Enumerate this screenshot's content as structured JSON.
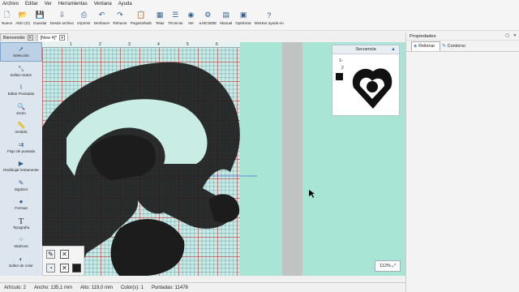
{
  "menu": [
    "Archivo",
    "Editar",
    "Ver",
    "Herramientas",
    "Ventana",
    "Ayuda"
  ],
  "toolbar": [
    {
      "label": "Nuevo",
      "icon": "new-file-icon"
    },
    {
      "label": "Abrir (O)",
      "icon": "open-folder-icon"
    },
    {
      "label": "Guardar",
      "icon": "save-icon"
    },
    {
      "label": "Desde archivo",
      "icon": "import-file-icon"
    },
    {
      "label": "Imprimir",
      "icon": "print-icon"
    },
    {
      "label": "Deshacer",
      "icon": "undo-icon"
    },
    {
      "label": "Rehacer",
      "icon": "redo-icon"
    },
    {
      "label": "Pegar/añadir",
      "icon": "paste-icon"
    },
    {
      "label": "Telas",
      "icon": "fabric-icon"
    },
    {
      "label": "Técnicas",
      "icon": "techniques-icon"
    },
    {
      "label": "Ver",
      "icon": "view-icon"
    },
    {
      "label": "a MC500E",
      "icon": "sewing-machine-icon"
    },
    {
      "label": "Manual",
      "icon": "manual-icon"
    },
    {
      "label": "Optimizar",
      "icon": "optimize-icon"
    },
    {
      "label": "Mostrar ayuda en",
      "icon": "help-icon"
    }
  ],
  "tabs": [
    {
      "label": "Bienvenido"
    },
    {
      "label": "[New 4]*"
    }
  ],
  "tools": [
    {
      "label": "Selección",
      "icon": "select-arrow-icon",
      "selected": true
    },
    {
      "label": "Editar nodos",
      "icon": "edit-nodes-icon"
    },
    {
      "label": "Editar Puntadas",
      "icon": "edit-stitches-icon"
    },
    {
      "label": "Zoom",
      "icon": "zoom-icon"
    },
    {
      "label": "medida",
      "icon": "measure-icon"
    },
    {
      "label": "Flujo de puntada",
      "icon": "stitch-flow-icon"
    },
    {
      "label": "Redibujar lentamente",
      "icon": "slow-redraw-icon"
    },
    {
      "label": "Digitizer",
      "icon": "digitizer-icon"
    },
    {
      "label": "Formas",
      "icon": "shapes-icon"
    },
    {
      "label": "Tipografía",
      "icon": "typography-icon"
    },
    {
      "label": "Matrices",
      "icon": "matrices-icon"
    },
    {
      "label": "Editor de color",
      "icon": "color-editor-icon"
    }
  ],
  "ruler_marks": [
    "1",
    "2",
    "3",
    "4",
    "5",
    "6"
  ],
  "sequence": {
    "title": "Secuencia",
    "items": [
      "1-",
      "2"
    ]
  },
  "properties": {
    "title": "Propiedades",
    "tabs": [
      {
        "label": "Rellenar"
      },
      {
        "label": "Contorno"
      }
    ]
  },
  "zoom_label": "112%",
  "status": {
    "artwork": "Artículo: 2",
    "width": "Ancho: 135,1 mm",
    "height": "Alto: 119,0 mm",
    "colors": "Color(s): 1",
    "stitches": "Puntadas: 11478"
  },
  "colors": {
    "canvas": "#a9e5d5",
    "design": "#1c1c1c",
    "accent": "#2f6fbf"
  }
}
